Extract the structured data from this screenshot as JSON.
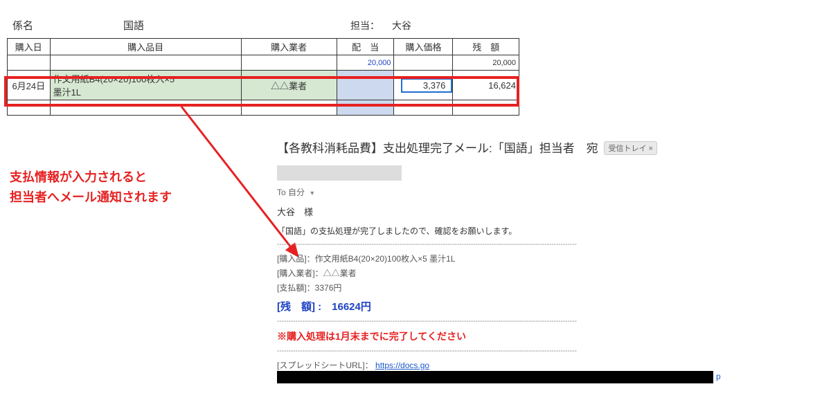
{
  "spreadsheet": {
    "dept_label": "係名",
    "subject": "国語",
    "tanto_label": "担当：",
    "tanto_name": "大谷",
    "columns": {
      "date": "購入日",
      "item": "購入品目",
      "vendor": "購入業者",
      "alloc": "配　当",
      "price": "購入価格",
      "balance": "残　額"
    },
    "top_alloc_value": "20,000",
    "top_balance_value": "20,000",
    "row": {
      "date": "6月24日",
      "item_line1": "作文用紙B4(20×20)100枚入×5",
      "item_line2": "墨汁1L",
      "vendor": "△△業者",
      "price": "3,376",
      "balance": "16,624"
    }
  },
  "annotation": {
    "line1": "支払情報が入力されると",
    "line2": "担当者へメール通知されます"
  },
  "email": {
    "subject": "【各教科消耗品費】支出処理完了メール:「国語」担当者　宛",
    "inbox_chip": "受信トレイ ×",
    "to_line": "To 自分",
    "greeting": "大谷　様",
    "intro": "「国語」の支払処理が完了しましたので、確認をお願いします。",
    "fields": {
      "item_label": "[購入品]：",
      "item_value": "作文用紙B4(20×20)100枚入×5 墨汁1L",
      "vendor_label": "[購入業者]：",
      "vendor_value": "△△業者",
      "amount_label": "[支払額]：",
      "amount_value": "3376円",
      "balance_label": "[残　額] :　",
      "balance_value": "16624円"
    },
    "warning": "※購入処理は1月末までに完了してください",
    "url_label": "[スプレッドシートURL]：",
    "url_text": "https://docs.go",
    "trailing": "p"
  }
}
